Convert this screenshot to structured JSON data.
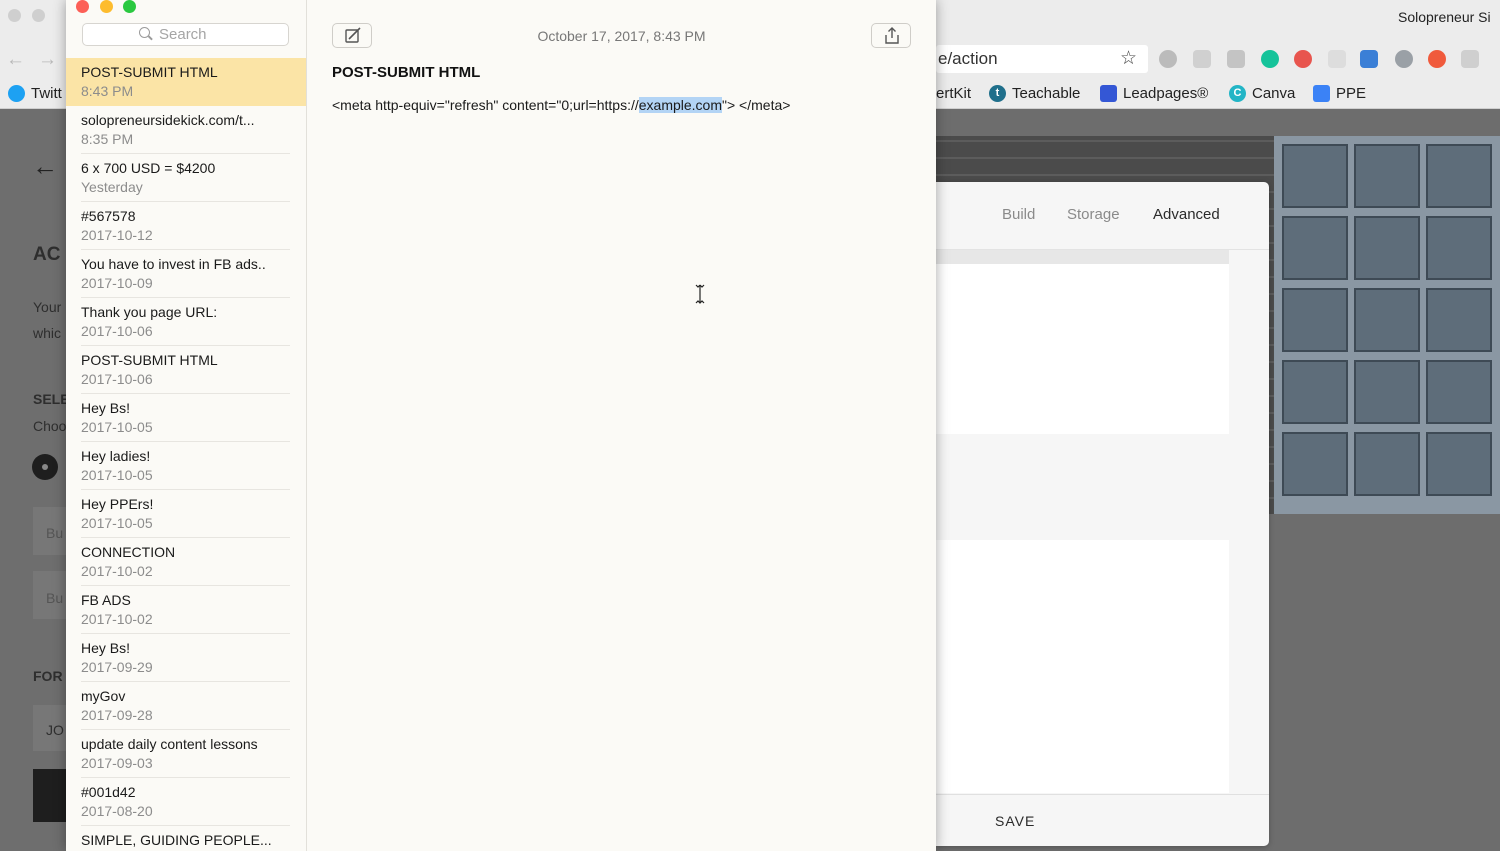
{
  "window": {
    "title": "Solopreneur Si"
  },
  "browser": {
    "url_fragment": "e/action",
    "bookmarks": [
      {
        "label": "Twitt",
        "color": "#1da1f2"
      },
      {
        "label": "ertKit",
        "color": ""
      },
      {
        "label": "Teachable",
        "color": "#1f6f8b"
      },
      {
        "label": "Leadpages®",
        "color": "#3457d5"
      },
      {
        "label": "Canva",
        "color": "#22b5c6"
      },
      {
        "label": "PPE",
        "color": "#3b82f6"
      }
    ],
    "left_page_fragments": [
      "AC",
      "Your",
      "whic",
      "SELE",
      "Choo",
      "Bu",
      "Bu",
      "FOR",
      "JO"
    ]
  },
  "panel": {
    "tabs": [
      "Build",
      "Storage",
      "Advanced"
    ],
    "active_tab": "Advanced",
    "save_label": "SAVE"
  },
  "notes": {
    "search_placeholder": "Search",
    "list": [
      {
        "title": "POST-SUBMIT HTML",
        "date": "8:43 PM",
        "selected": true
      },
      {
        "title": "solopreneursidekick.com/t...",
        "date": "8:35 PM"
      },
      {
        "title": "6 x 700 USD = $4200",
        "date": "Yesterday"
      },
      {
        "title": "#567578",
        "date": "2017-10-12"
      },
      {
        "title": "You have to invest in FB ads..",
        "date": "2017-10-09"
      },
      {
        "title": "Thank you page URL:",
        "date": "2017-10-06"
      },
      {
        "title": "POST-SUBMIT HTML",
        "date": "2017-10-06"
      },
      {
        "title": "Hey Bs!",
        "date": "2017-10-05"
      },
      {
        "title": "Hey ladies!",
        "date": "2017-10-05"
      },
      {
        "title": "Hey PPErs!",
        "date": "2017-10-05"
      },
      {
        "title": "CONNECTION",
        "date": "2017-10-02"
      },
      {
        "title": "FB ADS",
        "date": "2017-10-02"
      },
      {
        "title": "Hey Bs!",
        "date": "2017-09-29"
      },
      {
        "title": "myGov",
        "date": "2017-09-28"
      },
      {
        "title": "update daily content lessons",
        "date": "2017-09-03"
      },
      {
        "title": "#001d42",
        "date": "2017-08-20"
      },
      {
        "title": "SIMPLE, GUIDING PEOPLE...",
        "date": ""
      }
    ],
    "editor": {
      "timestamp": "October 17, 2017, 8:43 PM",
      "heading": "POST-SUBMIT HTML",
      "body_before": "<meta http-equiv=\"refresh\" content=\"0;url=https://",
      "body_selected": "example.com",
      "body_after": "\"> </meta>"
    },
    "selection_color": "#b3d4f5",
    "selected_note_color": "#fbe4a6"
  }
}
